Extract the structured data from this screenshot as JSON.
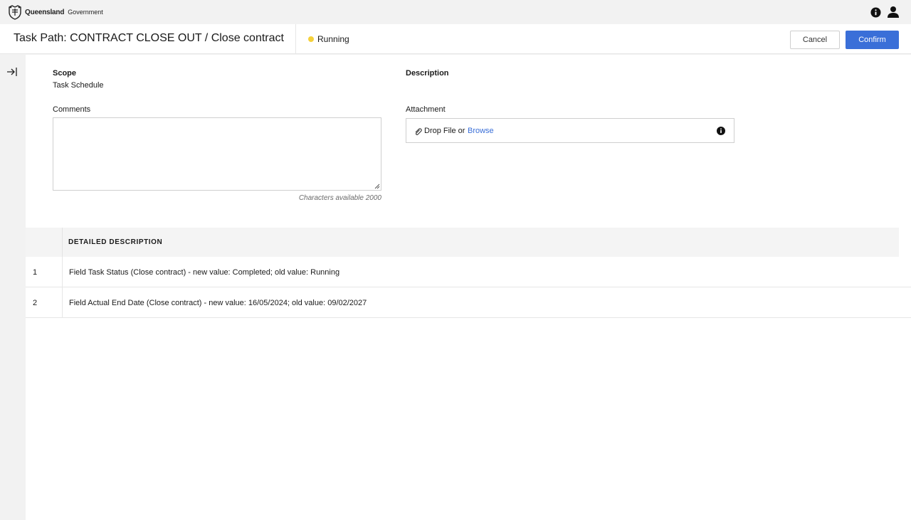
{
  "brand": {
    "name_strong": "Queensland",
    "name_light": "Government"
  },
  "header": {
    "title": "Task Path: CONTRACT CLOSE OUT / Close contract",
    "status": "Running",
    "status_color": "#f5d13b",
    "cancel_label": "Cancel",
    "confirm_label": "Confirm",
    "accent_color": "#3a6fd8"
  },
  "form": {
    "scope_label": "Scope",
    "scope_value": "Task Schedule",
    "description_label": "Description",
    "comments_label": "Comments",
    "comments_value": "",
    "char_count": "Characters available 2000",
    "attachment_label": "Attachment",
    "drop_text": "Drop File or",
    "browse_label": "Browse"
  },
  "table": {
    "column_header": "DETAILED DESCRIPTION",
    "rows": [
      {
        "num": "1",
        "desc": "Field Task Status (Close contract) - new value: Completed; old value: Running"
      },
      {
        "num": "2",
        "desc": "Field Actual End Date (Close contract) - new value: 16/05/2024; old value: 09/02/2027"
      }
    ]
  },
  "icons": {
    "crest": "queensland-crest-icon",
    "info": "info-icon",
    "user": "user-icon",
    "collapse": "expand-sidebar-icon",
    "paperclip": "paperclip-icon"
  }
}
